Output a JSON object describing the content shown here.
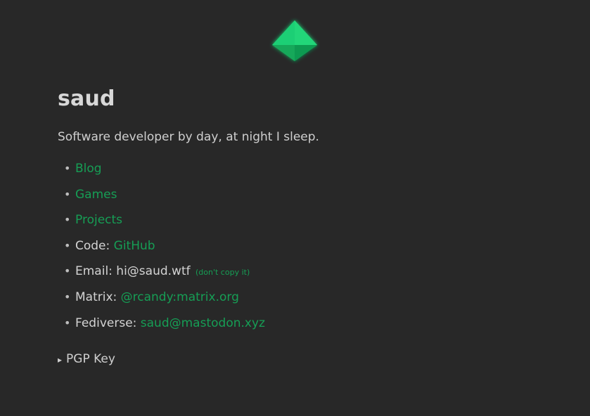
{
  "logo": {
    "icon": "green-gem-icon",
    "color": "#1ecf74"
  },
  "title": "saud",
  "tagline": "Software developer by day, at night I sleep.",
  "links": {
    "blog": "Blog",
    "games": "Games",
    "projects": "Projects",
    "code_label": "Code: ",
    "code_link": "GitHub",
    "email_label": "Email: hi@saud.wtf",
    "email_note": "(don't copy it)",
    "matrix_label": "Matrix: ",
    "matrix_link": "@rcandy:matrix.org",
    "fediverse_label": "Fediverse: ",
    "fediverse_link": "saud@mastodon.xyz"
  },
  "pgp": {
    "label": "PGP Key",
    "marker": "▸"
  },
  "colors": {
    "background": "#282828",
    "link": "#169e55",
    "text": "#cfcfcf"
  }
}
